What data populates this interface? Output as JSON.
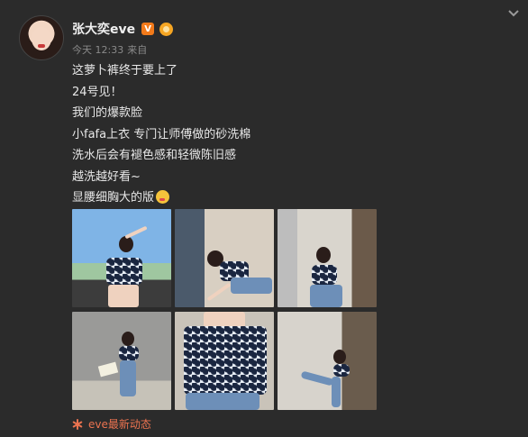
{
  "post": {
    "username": "张大奕eve",
    "vip_badge": "V",
    "meta": {
      "time": "今天 12:33",
      "source_prefix": "来自"
    },
    "text_lines": [
      "这萝卜裤终于要上了",
      "24号见！",
      "我们的爆款脸",
      "小fafa上衣 专门让师傅做的砂洗棉",
      "洗水后会有褪色感和轻微陈旧感",
      "越洗越好看~",
      "显腰细胸大的版"
    ],
    "source_link": "eve最新动态"
  },
  "icons": {
    "avatar": "profile-photo",
    "vip": "vip-v-badge-icon",
    "member": "lion-member-icon",
    "more": "chevron-down-icon",
    "emoji": "heart-eyes-emoji-icon",
    "source": "asterisk-source-icon"
  },
  "colors": {
    "background": "#2b2b2b",
    "text": "#e8e8e8",
    "meta": "#8a8a8a",
    "link": "#eb7350",
    "vip": "#f27a1a"
  }
}
